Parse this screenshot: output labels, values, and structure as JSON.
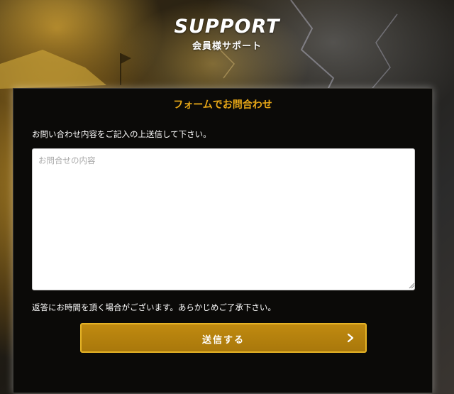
{
  "hero": {
    "logo_text": "SUPPORT",
    "subtitle": "会員様サポート"
  },
  "form": {
    "title": "フォームでお問合わせ",
    "instruction": "お問い合わせ内容をご記入の上送信して下さい。",
    "textarea_placeholder": "お問合せの内容",
    "textarea_value": "",
    "notice": "返答にお時間を頂く場合がございます。あらかじめご了承下さい。",
    "submit_label": "送信する",
    "submit_icon": "chevron-right-icon"
  },
  "colors": {
    "accent": "#e8a817",
    "button": "#b5820d",
    "button_border": "#e5b326",
    "panel_bg": "#0b0a08"
  }
}
